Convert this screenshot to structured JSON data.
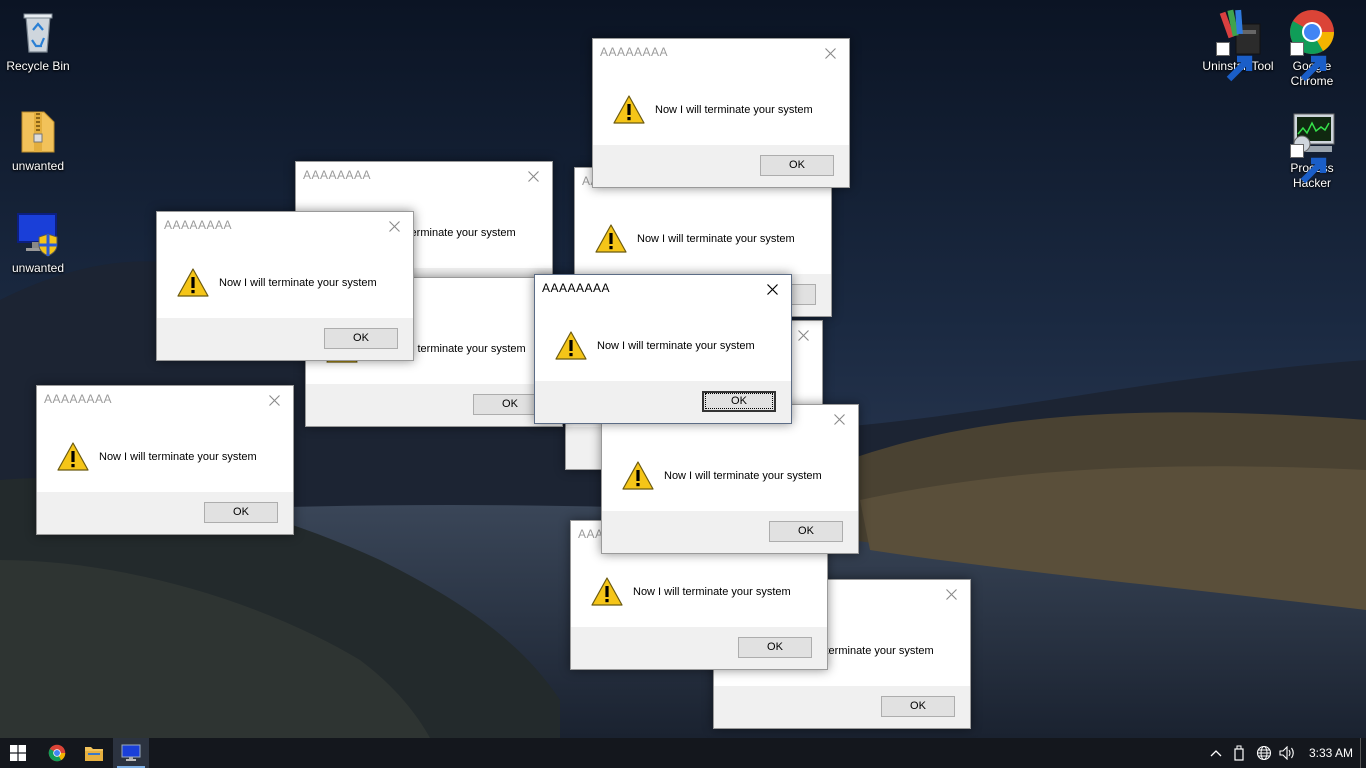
{
  "desktop": {
    "icons": [
      {
        "label": "Recycle Bin",
        "icon": "recycle-bin-icon"
      },
      {
        "label": "unwanted",
        "icon": "zip-folder-icon"
      },
      {
        "label": "unwanted",
        "icon": "monitor-shield-icon"
      },
      {
        "label": "Uninstall Tool",
        "icon": "uninstall-tool-icon"
      },
      {
        "label": "Google Chrome",
        "icon": "chrome-icon"
      },
      {
        "label": "Process Hacker",
        "icon": "process-hacker-icon"
      }
    ]
  },
  "dialog": {
    "title": "AAAAAAAA",
    "message": "Now I will terminate your system",
    "ok_label": "OK",
    "icon": "warning-icon",
    "close_icon": "close-icon"
  },
  "dialogs_count": 11,
  "active_dialog": "dialog-center",
  "taskbar": {
    "items": [
      {
        "name": "start",
        "icon": "windows-logo-icon"
      },
      {
        "name": "chrome",
        "icon": "chrome-icon"
      },
      {
        "name": "file-explorer",
        "icon": "folder-icon"
      },
      {
        "name": "running-app",
        "icon": "monitor-icon",
        "running": true
      }
    ],
    "tray": [
      "chevron-up-icon",
      "usb-drive-icon",
      "network-globe-icon",
      "volume-icon"
    ],
    "clock": "3:33 AM"
  },
  "colors": {
    "warning_yellow": "#f5c518",
    "taskbar_bg": "#14171d",
    "dialog_footer": "#f0f0f0",
    "accent_blue": "#7fb0e6"
  }
}
